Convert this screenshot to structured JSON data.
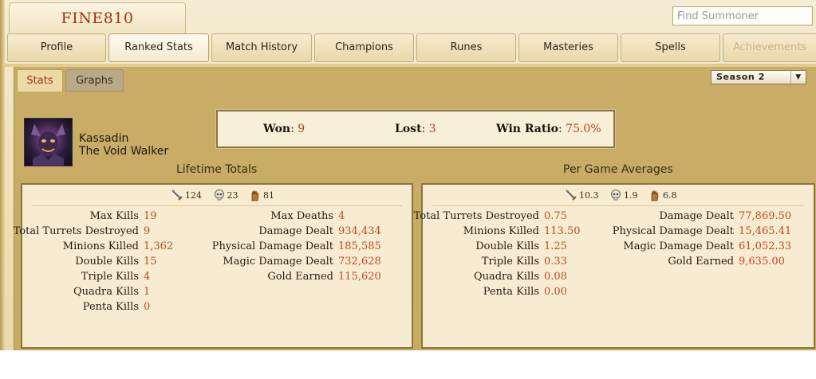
{
  "summoner": {
    "name": "FINE810"
  },
  "search": {
    "placeholder": "Find Summoner"
  },
  "nav": {
    "tabs": [
      {
        "label": "Profile"
      },
      {
        "label": "Ranked Stats",
        "active": true
      },
      {
        "label": "Match History"
      },
      {
        "label": "Champions"
      },
      {
        "label": "Runes"
      },
      {
        "label": "Masteries"
      },
      {
        "label": "Spells"
      },
      {
        "label": "Achievements",
        "disabled": true
      }
    ]
  },
  "subtabs": {
    "stats": "Stats",
    "graphs": "Graphs"
  },
  "season": {
    "selected": "Season 2"
  },
  "champion": {
    "name": "Kassadin",
    "title": "The Void Walker"
  },
  "record": {
    "won_label": "Won",
    "won": "9",
    "lost_label": "Lost",
    "lost": "3",
    "ratio_label": "Win Ratio",
    "ratio": "75.0%"
  },
  "lifetime": {
    "heading": "Lifetime Totals",
    "kills": "124",
    "deaths": "23",
    "assists": "81",
    "left": [
      {
        "label": "Max Kills",
        "value": "19"
      },
      {
        "label": "Total Turrets Destroyed",
        "value": "9"
      },
      {
        "label": "Minions Killed",
        "value": "1,362"
      },
      {
        "label": "Double Kills",
        "value": "15"
      },
      {
        "label": "Triple Kills",
        "value": "4"
      },
      {
        "label": "Quadra Kills",
        "value": "1"
      },
      {
        "label": "Penta Kills",
        "value": "0"
      }
    ],
    "right": [
      {
        "label": "Max Deaths",
        "value": "4"
      },
      {
        "label": "Damage Dealt",
        "value": "934,434"
      },
      {
        "label": "Physical Damage Dealt",
        "value": "185,585"
      },
      {
        "label": "Magic Damage Dealt",
        "value": "732,628"
      },
      {
        "label": "Gold Earned",
        "value": "115,620"
      }
    ]
  },
  "averages": {
    "heading": "Per Game Averages",
    "kills": "10.3",
    "deaths": "1.9",
    "assists": "6.8",
    "left": [
      {
        "label": "Total Turrets Destroyed",
        "value": "0.75"
      },
      {
        "label": "Minions Killed",
        "value": "113.50"
      },
      {
        "label": "Double Kills",
        "value": "1.25"
      },
      {
        "label": "Triple Kills",
        "value": "0.33"
      },
      {
        "label": "Quadra Kills",
        "value": "0.08"
      },
      {
        "label": "Penta Kills",
        "value": "0.00"
      }
    ],
    "right": [
      {
        "label": "Damage Dealt",
        "value": "77,869.50"
      },
      {
        "label": "Physical Damage Dealt",
        "value": "15,465.41"
      },
      {
        "label": "Magic Damage Dealt",
        "value": "61,052.33"
      },
      {
        "label": "Gold Earned",
        "value": "9,635.00"
      }
    ]
  },
  "icons": {
    "kills": "crossed-swords-icon",
    "deaths": "skull-icon",
    "assists": "hand-icon"
  },
  "colors": {
    "accent": "#b3421f",
    "panel": "#c9ad66",
    "box": "#f7ecd2"
  }
}
